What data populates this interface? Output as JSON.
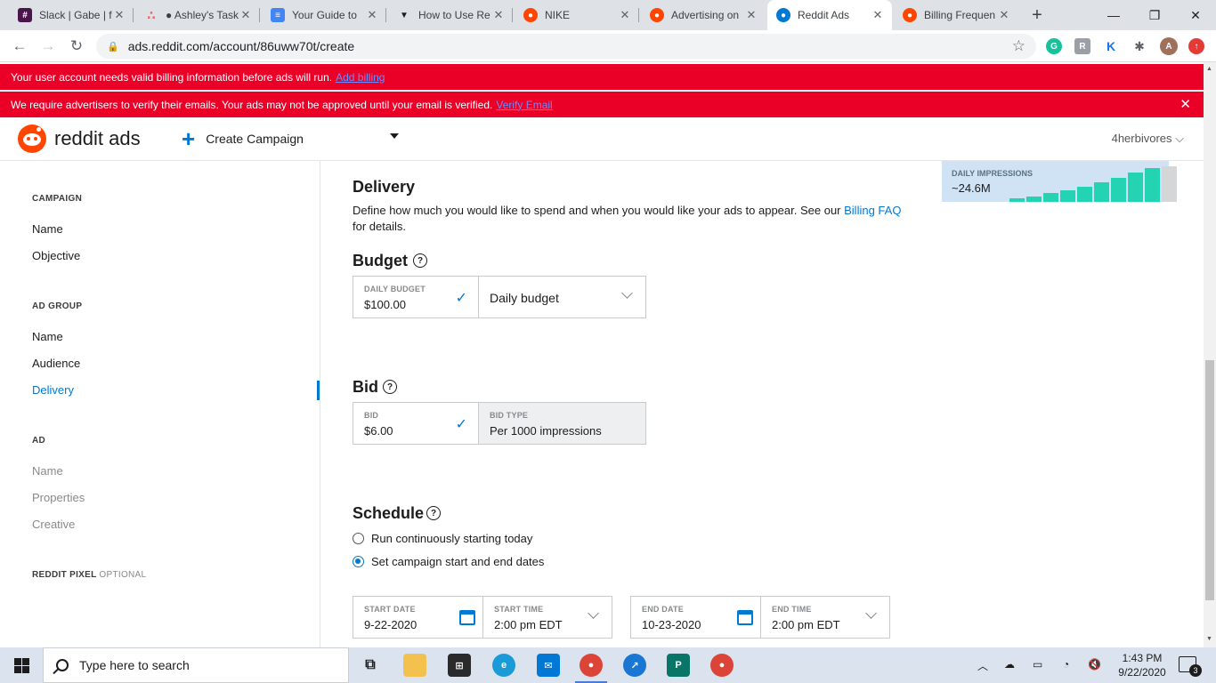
{
  "browser": {
    "tabs": [
      {
        "title": "Slack | Gabe | f",
        "favicon_color": "#4a154b",
        "glyph": "#"
      },
      {
        "title": "● Ashley's Task",
        "favicon_color": "#f06a6a",
        "glyph": "∴"
      },
      {
        "title": "Your Guide to",
        "favicon_color": "#4285f4",
        "glyph": "≡"
      },
      {
        "title": "How to Use Re",
        "favicon_color": "#1c1c1c",
        "glyph": "▼"
      },
      {
        "title": "NIKE",
        "favicon_color": "#ff4500",
        "glyph": "●"
      },
      {
        "title": "Advertising on",
        "favicon_color": "#ff4500",
        "glyph": "●"
      },
      {
        "title": "Reddit Ads",
        "favicon_color": "#0079d3",
        "glyph": "●"
      },
      {
        "title": "Billing Frequen",
        "favicon_color": "#ff4500",
        "glyph": "●"
      }
    ],
    "url": "ads.reddit.com/account/86uww70t/create"
  },
  "banners": {
    "billing_text": "Your user account needs valid billing information before ads will run.",
    "billing_link": "Add billing",
    "verify_text": "We require advertisers to verify their emails. Your ads may not be approved until your email is verified.",
    "verify_link": "Verify Email"
  },
  "header": {
    "logo_text": "reddit ads",
    "create_label": "Create Campaign",
    "account_name": "4herbivores ⌵"
  },
  "sidebar": {
    "campaign_heading": "CAMPAIGN",
    "campaign_items": [
      "Name",
      "Objective"
    ],
    "adgroup_heading": "AD GROUP",
    "adgroup_items": [
      "Name",
      "Audience",
      "Delivery"
    ],
    "ad_heading": "AD",
    "ad_items": [
      "Name",
      "Properties",
      "Creative"
    ],
    "pixel_heading": "REDDIT PIXEL",
    "pixel_optional": "OPTIONAL"
  },
  "delivery": {
    "title": "Delivery",
    "desc_before": "Define how much you would like to spend and when you would like your ads to appear. See our ",
    "desc_link": "Billing FAQ",
    "desc_after": " for details."
  },
  "budget": {
    "title": "Budget",
    "daily_label": "DAILY BUDGET",
    "daily_value": "$100.00",
    "type_value": "Daily budget"
  },
  "bid": {
    "title": "Bid",
    "bid_label": "BID",
    "bid_value": "$6.00",
    "type_label": "BID TYPE",
    "type_value": "Per 1000 impressions"
  },
  "schedule": {
    "title": "Schedule",
    "option_continuous": "Run continuously starting today",
    "option_dates": "Set campaign start and end dates",
    "start_date_label": "START DATE",
    "start_date": "9-22-2020",
    "start_time_label": "START TIME",
    "start_time": "2:00 pm EDT",
    "end_date_label": "END DATE",
    "end_date": "10-23-2020",
    "end_time_label": "END TIME",
    "end_time": "2:00 pm EDT"
  },
  "impressions": {
    "label": "DAILY IMPRESSIONS",
    "value": "~24.6M",
    "bars": [
      0.1,
      0.15,
      0.25,
      0.33,
      0.43,
      0.55,
      0.68,
      0.83,
      0.95,
      1.0
    ]
  },
  "taskbar": {
    "search_placeholder": "Type here to search",
    "time": "1:43 PM",
    "date": "9/22/2020",
    "notifications": "3"
  },
  "colors": {
    "banner_red": "#ea0027",
    "reddit_orange": "#ff4500",
    "accent_blue": "#0079d3",
    "bar_teal": "#24d3b2"
  }
}
